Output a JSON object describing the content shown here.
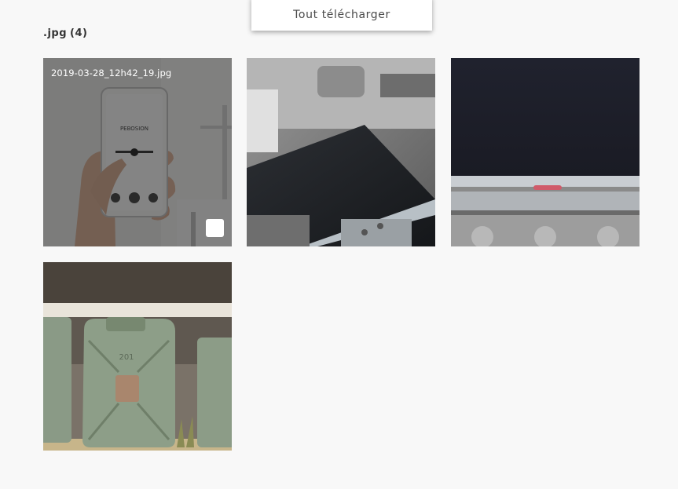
{
  "toolbar": {
    "download_all_label": "Tout télécharger"
  },
  "group": {
    "extension": ".jpg",
    "count": "(4)"
  },
  "items": [
    {
      "filename": "2019-03-28_12h42_19.jpg",
      "hovered": true,
      "selected": false
    },
    {
      "filename": "",
      "hovered": false,
      "selected": false
    },
    {
      "filename": "",
      "hovered": false,
      "selected": false
    },
    {
      "filename": "",
      "hovered": false,
      "selected": false
    }
  ],
  "colors": {
    "background": "#f8f8f8",
    "overlay": "#232323",
    "text_dark": "#333333"
  }
}
